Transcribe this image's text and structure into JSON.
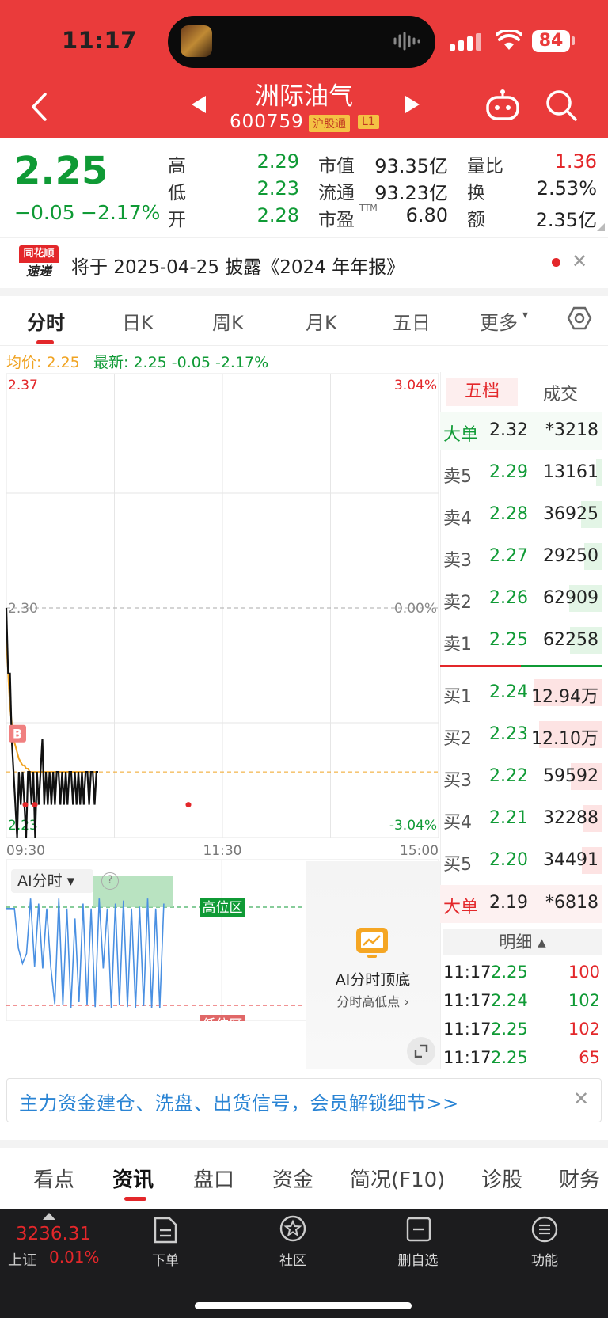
{
  "status": {
    "time": "11:17",
    "battery": "84"
  },
  "header": {
    "stock_name": "洲际油气",
    "stock_code": "600759",
    "tag_connect": "沪股通",
    "tag_level": "L1"
  },
  "quote": {
    "price": "2.25",
    "change": "−0.05",
    "change_pct": "−2.17%",
    "fields": [
      {
        "label": "高",
        "value": "2.29",
        "color": "#0f9a35"
      },
      {
        "label": "低",
        "value": "2.23",
        "color": "#0f9a35"
      },
      {
        "label": "开",
        "value": "2.28",
        "color": "#0f9a35"
      },
      {
        "label": "市值",
        "value": "93.35亿",
        "color": "#222222"
      },
      {
        "label": "流通",
        "value": "93.23亿",
        "color": "#222222"
      },
      {
        "label": "市盈",
        "sup": "TTM",
        "value": "6.80",
        "color": "#222222"
      },
      {
        "label": "量比",
        "value": "1.36",
        "color": "#e3272a"
      },
      {
        "label": "换",
        "value": "2.53%",
        "color": "#222222"
      },
      {
        "label": "额",
        "value": "2.35亿",
        "color": "#222222"
      }
    ]
  },
  "notice": {
    "logo_top": "同花顺",
    "logo_bottom": "速递",
    "text": "将于 2025-04-25 披露《2024 年年报》"
  },
  "chart_tabs": [
    "分时",
    "日K",
    "周K",
    "月K",
    "五日",
    "更多"
  ],
  "price_line": {
    "avg": "均价: 2.25",
    "latest": "最新: 2.25  -0.05  -2.17%"
  },
  "chart_data": {
    "type": "line",
    "title": "",
    "x_ticks": [
      "09:30",
      "11:30",
      "15:00"
    ],
    "y_left_ticks": [
      "2.37",
      "2.30",
      "2.23"
    ],
    "y_right_ticks": [
      "3.04%",
      "0.00%",
      "-3.04%"
    ],
    "ylim": [
      2.23,
      2.37
    ],
    "series": [
      {
        "values": [
          2.3,
          2.28,
          2.28,
          2.26,
          2.25,
          2.24,
          2.23,
          2.25,
          2.24,
          2.25,
          2.24,
          2.23,
          2.25,
          2.25,
          2.24,
          2.25,
          2.23,
          2.25,
          2.24,
          2.25,
          2.26,
          2.24,
          2.25,
          2.24,
          2.25,
          2.24,
          2.25,
          2.24,
          2.25,
          2.25,
          2.24,
          2.25,
          2.24,
          2.25,
          2.24,
          2.25,
          2.25,
          2.24,
          2.25,
          2.24,
          2.25,
          2.24,
          2.25,
          2.24,
          2.25,
          2.25,
          2.24,
          2.25,
          2.25,
          2.24,
          2.25,
          2.25
        ],
        "color": "#111111"
      },
      {
        "values": [
          2.29,
          2.28,
          2.27,
          2.265,
          2.26,
          2.258,
          2.256,
          2.254,
          2.253,
          2.252,
          2.252,
          2.251,
          2.251,
          2.25,
          2.25,
          2.25,
          2.25,
          2.25,
          2.25,
          2.25,
          2.25,
          2.25,
          2.25,
          2.25,
          2.25,
          2.25,
          2.25,
          2.25,
          2.25,
          2.25,
          2.25,
          2.25,
          2.25,
          2.25,
          2.25,
          2.25,
          2.25,
          2.25,
          2.25,
          2.25,
          2.25,
          2.25,
          2.25,
          2.25,
          2.25,
          2.25,
          2.25,
          2.25,
          2.25,
          2.25,
          2.25,
          2.25
        ],
        "color": "#f0a322"
      }
    ],
    "marker": "B"
  },
  "ai_panel": {
    "label": "AI分时",
    "high_zone": "高位区",
    "low_zone": "低位区",
    "promo_title": "AI分时顶底",
    "promo_sub": "分时高低点"
  },
  "order_book": {
    "tabs": [
      "五档",
      "成交"
    ],
    "big_top": {
      "label": "大单",
      "price": "2.32",
      "vol": "*3218"
    },
    "asks": [
      {
        "label": "卖5",
        "price": "2.29",
        "vol": "13161",
        "bar": 0.08
      },
      {
        "label": "卖4",
        "price": "2.28",
        "vol": "36925",
        "bar": 0.3
      },
      {
        "label": "卖3",
        "price": "2.27",
        "vol": "29250",
        "bar": 0.25
      },
      {
        "label": "卖2",
        "price": "2.26",
        "vol": "62909",
        "bar": 0.48
      },
      {
        "label": "卖1",
        "price": "2.25",
        "vol": "62258",
        "bar": 0.46
      }
    ],
    "bids": [
      {
        "label": "买1",
        "price": "2.24",
        "vol": "12.94万",
        "bar": 0.99
      },
      {
        "label": "买2",
        "price": "2.23",
        "vol": "12.10万",
        "bar": 0.92
      },
      {
        "label": "买3",
        "price": "2.22",
        "vol": "59592",
        "bar": 0.45
      },
      {
        "label": "买4",
        "price": "2.21",
        "vol": "32288",
        "bar": 0.27
      },
      {
        "label": "买5",
        "price": "2.20",
        "vol": "34491",
        "bar": 0.29
      }
    ],
    "big_bottom": {
      "label": "大单",
      "price": "2.19",
      "vol": "*6818"
    },
    "detail_header": "明细",
    "ticks": [
      {
        "time": "11:17",
        "price": "2.25",
        "vol": "100",
        "color": "#e3272a"
      },
      {
        "time": "11:17",
        "price": "2.24",
        "vol": "102",
        "color": "#0f9a35"
      },
      {
        "time": "11:17",
        "price": "2.25",
        "vol": "102",
        "color": "#e3272a"
      },
      {
        "time": "11:17",
        "price": "2.25",
        "vol": "65",
        "color": "#e3272a"
      }
    ]
  },
  "banner": {
    "text": "主力资金建仓、洗盘、出货信号，会员解锁细节>>"
  },
  "news_tabs": [
    "看点",
    "资讯",
    "盘口",
    "资金",
    "简况(F10)",
    "诊股",
    "财务"
  ],
  "bottom_nav": {
    "index_value": "3236.31",
    "index_name": "上证",
    "index_change": "0.01%",
    "items": [
      "下单",
      "社区",
      "删自选",
      "功能"
    ]
  }
}
